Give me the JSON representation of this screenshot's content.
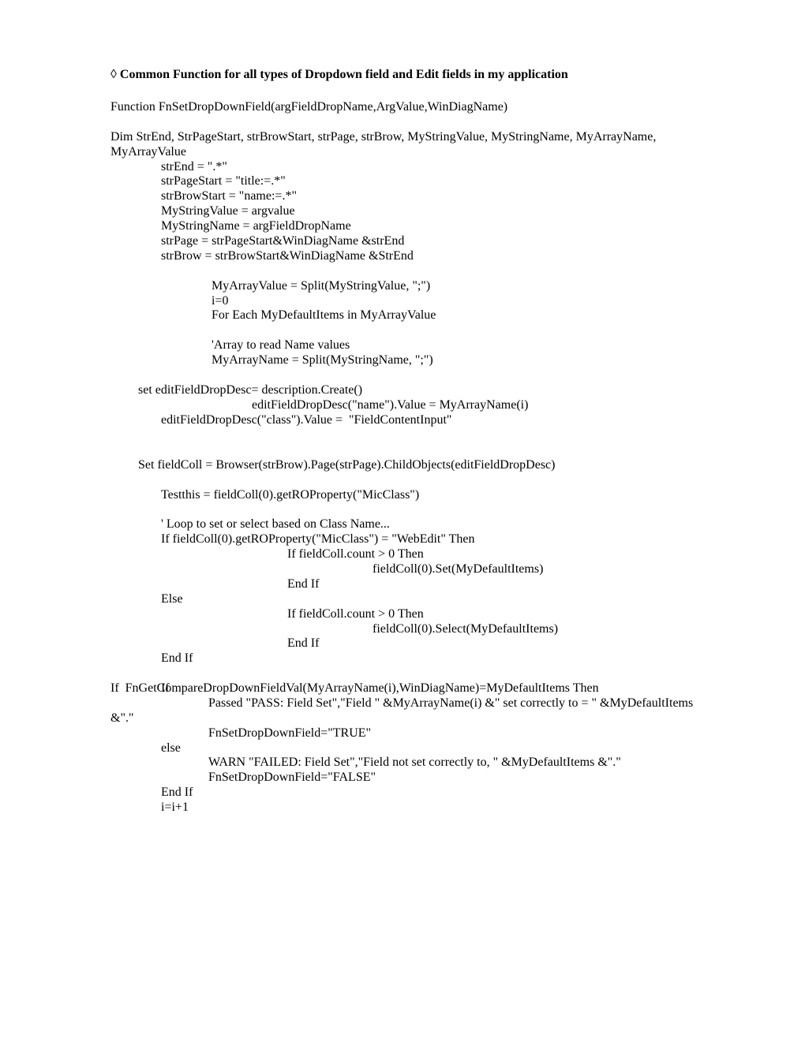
{
  "title": "Common Function for all types of Dropdown field and Edit fields in my application",
  "line_func": "Function FnSetDropDownField(argFieldDropName,ArgValue,WinDiagName)",
  "line_dim": "Dim StrEnd, StrPageStart, strBrowStart, strPage, strBrow, MyStringValue, MyStringName, MyArrayName, MyArrayValue",
  "l1": "strEnd = \".*\"",
  "l2": "strPageStart = \"title:=.*\"",
  "l3": "strBrowStart = \"name:=.*\"",
  "l4": "MyStringValue = argvalue",
  "l5": "MyStringName = argFieldDropName",
  "l6": "strPage = strPageStart&WinDiagName &strEnd",
  "l7": "strBrow = strBrowStart&WinDiagName &StrEnd",
  "l8": "MyArrayValue = Split(MyStringValue, \";\")",
  "l9": "i=0",
  "l10": "For Each MyDefaultItems in MyArrayValue",
  "l11": "'Array to read Name values",
  "l12": "MyArrayName = Split(MyStringName, \";\")",
  "l13": "set editFieldDropDesc= description.Create()",
  "l14": "                                    editFieldDropDesc(\"name\").Value = MyArrayName(i)",
  "l15": "editFieldDropDesc(\"class\").Value =  \"FieldContentInput\"",
  "l16": "Set fieldColl = Browser(strBrow).Page(strPage).ChildObjects(editFieldDropDesc)",
  "l17": "Testthis = fieldColl(0).getROProperty(\"MicClass\")",
  "l18": "' Loop to set or select based on Class Name...",
  "l19": "If fieldColl(0).getROProperty(\"MicClass\") = \"WebEdit\" Then",
  "l20": "                                        If fieldColl.count > 0 Then",
  "l21": "                                                                   fieldColl(0).Set(MyDefaultItems)",
  "l22": "                                        End If",
  "l23": "Else",
  "l24": "                                        If fieldColl.count > 0 Then",
  "l25": "                                                                   fieldColl(0).Select(MyDefaultItems)",
  "l26": "                                        End If",
  "l27": "End If",
  "l28": "If  FnGetCompareDropDownFieldVal(MyArrayName(i),WinDiagName)=MyDefaultItems Then",
  "l29": "                               Passed \"PASS: Field Set\",\"Field \" &MyArrayName(i) &\" set correctly to = \" &MyDefaultItems &\".\"",
  "l30": "                               FnSetDropDownField=\"TRUE\"",
  "l31": "                else",
  "l32": "                               WARN \"FAILED: Field Set\",\"Field not set correctly to, \" &MyDefaultItems &\".\"",
  "l33": "                               FnSetDropDownField=\"FALSE\"",
  "l34": "End If",
  "l35": "i=i+1"
}
